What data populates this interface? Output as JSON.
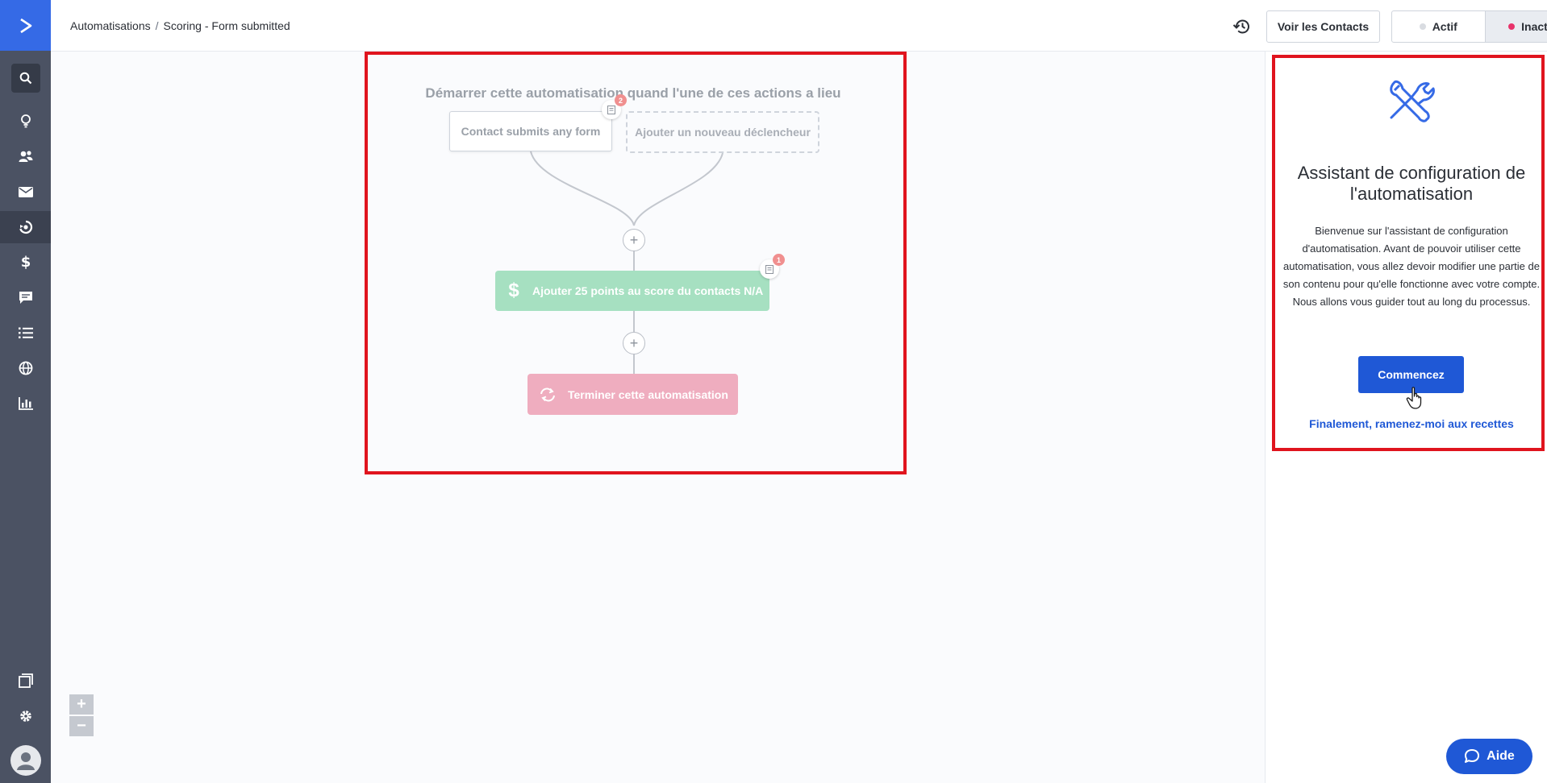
{
  "breadcrumb": {
    "parent": "Automatisations",
    "separator": "/",
    "current": "Scoring - Form submitted"
  },
  "header": {
    "contacts_button": "Voir les Contacts",
    "status_toggle": {
      "active_label": "Actif",
      "inactive_label": "Inactif",
      "selected": "Inactif"
    }
  },
  "sidebar": {
    "items": [
      {
        "icon": "search-icon"
      },
      {
        "icon": "lightbulb-icon"
      },
      {
        "icon": "contacts-icon"
      },
      {
        "icon": "email-icon"
      },
      {
        "icon": "automation-icon"
      },
      {
        "icon": "dollar-icon"
      },
      {
        "icon": "conversations-icon"
      },
      {
        "icon": "lists-icon"
      },
      {
        "icon": "globe-icon"
      },
      {
        "icon": "reports-icon"
      }
    ],
    "bottom": [
      {
        "icon": "pages-icon"
      },
      {
        "icon": "gear-icon"
      },
      {
        "icon": "avatar-icon"
      }
    ]
  },
  "workflow": {
    "trigger_title": "Démarrer cette automatisation quand l'une de ces actions a lieu",
    "trigger": "Contact submits any form",
    "trigger_badge": "2",
    "add_trigger": "Ajouter un nouveau déclencheur",
    "action": "Ajouter 25 points au score du contacts N/A",
    "action_badge": "1",
    "end": "Terminer cette automatisation",
    "plus_symbol": "+"
  },
  "zoom": {
    "in": "+",
    "out": "−"
  },
  "panel": {
    "title": "Assistant de configuration de l'automatisation",
    "text": "Bienvenue sur l'assistant de configuration d'automatisation. Avant de pouvoir utiliser cette automatisation, vous allez devoir modifier une partie de son contenu pour qu'elle fonctionne avec votre compte. Nous allons vous guider tout au long du processus.",
    "start_button": "Commencez",
    "back_link": "Finalement, ramenez-moi aux recettes"
  },
  "help_button": "Aide",
  "colors": {
    "sidebar": "#4b5263",
    "brand_blue": "#356ae6",
    "primary_button": "#1f58d6",
    "action_green": "#a6e0c1",
    "end_pink": "#efadbf",
    "highlight_red": "#e0141e",
    "inactive_dot": "#e8336b",
    "active_dot": "#d9dce1"
  }
}
